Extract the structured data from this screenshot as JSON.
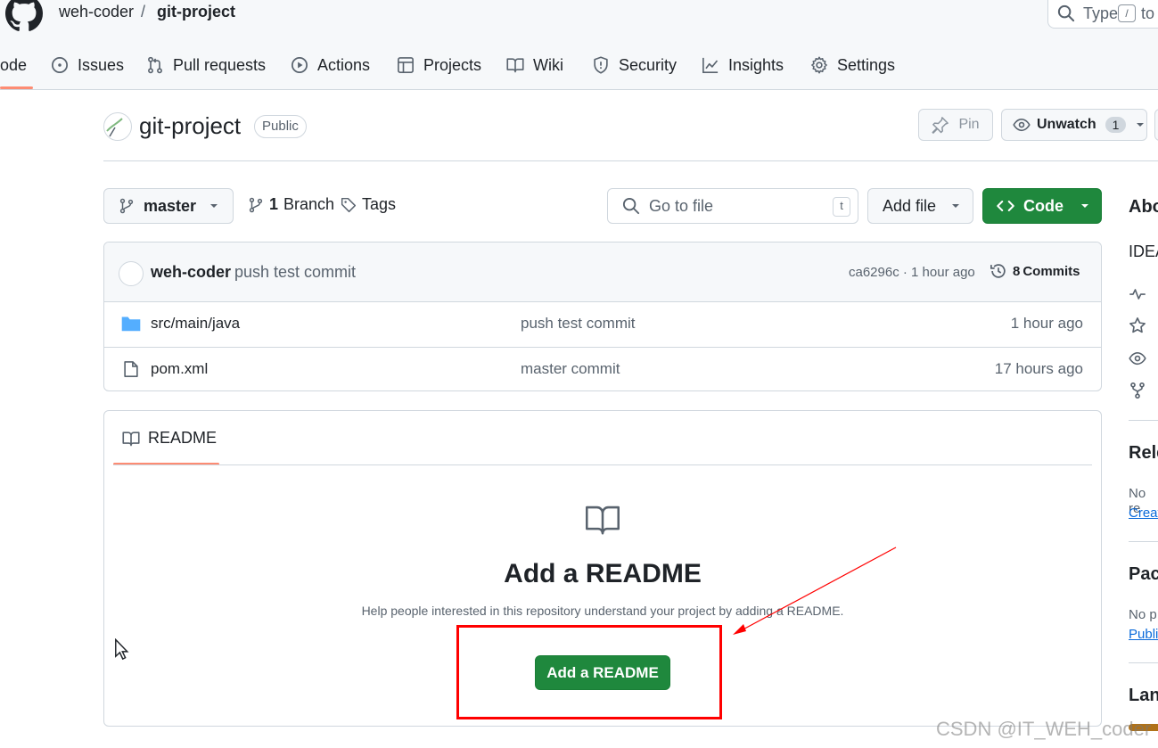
{
  "header": {
    "owner": "weh-coder",
    "separator": "/",
    "repo": "git-project",
    "search_placeholder": "Type",
    "search_key": "/",
    "search_suffix": "to"
  },
  "nav": {
    "items": [
      {
        "label": "ode",
        "icon": "code-icon"
      },
      {
        "label": "Issues",
        "icon": "issue-icon"
      },
      {
        "label": "Pull requests",
        "icon": "pull-request-icon"
      },
      {
        "label": "Actions",
        "icon": "play-icon"
      },
      {
        "label": "Projects",
        "icon": "table-icon"
      },
      {
        "label": "Wiki",
        "icon": "book-icon"
      },
      {
        "label": "Security",
        "icon": "shield-icon"
      },
      {
        "label": "Insights",
        "icon": "graph-icon"
      },
      {
        "label": "Settings",
        "icon": "gear-icon"
      }
    ]
  },
  "repo_header": {
    "name": "git-project",
    "visibility": "Public",
    "pin_label": "Pin",
    "watch_label": "Unwatch",
    "watch_count": "1"
  },
  "toolbar": {
    "branch": "master",
    "branch_count": "1",
    "branch_label": "Branch",
    "tags_label": "Tags",
    "goto_placeholder": "Go to file",
    "goto_key": "t",
    "add_file_label": "Add file",
    "code_label": "Code"
  },
  "commit": {
    "author": "weh-coder",
    "message": "push test commit",
    "sha_time": "ca6296c · 1 hour ago",
    "count": "8",
    "count_label": "Commits"
  },
  "files": [
    {
      "name": "src/main/java",
      "type": "folder",
      "message": "push test commit",
      "time": "1 hour ago"
    },
    {
      "name": "pom.xml",
      "type": "file",
      "message": "master commit",
      "time": "17 hours ago"
    }
  ],
  "readme": {
    "tab_label": "README",
    "title": "Add a README",
    "description": "Help people interested in this repository understand your project by adding a README.",
    "button_label": "Add a README"
  },
  "sidebar": {
    "about": "Abo",
    "about_desc": "IDEA",
    "releases": "Rele",
    "releases_text": "No re",
    "releases_link": "Creat",
    "packages": "Pack",
    "packages_text": "No p",
    "packages_link": "Publi",
    "languages": "Lan"
  },
  "watermark": "CSDN @IT_WEH_coder",
  "colors": {
    "accent_green": "#1f883d",
    "nav_underline": "#fd8c73",
    "annotation_red": "#ff0000",
    "link_blue": "#0969da"
  }
}
